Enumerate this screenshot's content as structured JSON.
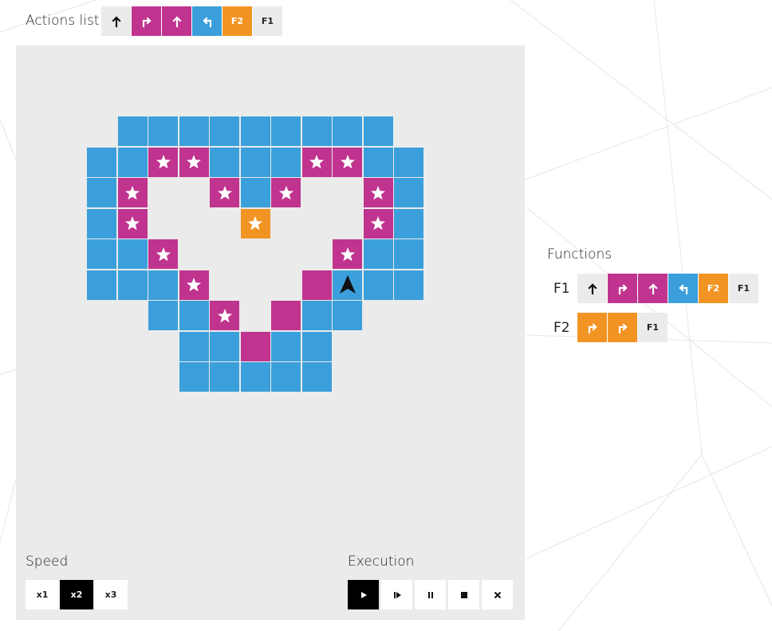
{
  "actions": {
    "label": "Actions list",
    "commands": [
      {
        "dir": "forward",
        "color": "none"
      },
      {
        "dir": "right",
        "color": "magenta"
      },
      {
        "dir": "forward",
        "color": "magenta"
      },
      {
        "dir": "left",
        "color": "blue"
      },
      {
        "text": "F2",
        "color": "orange"
      },
      {
        "text": "F1",
        "color": "none"
      }
    ]
  },
  "board": {
    "cells": [
      {
        "r": 0,
        "c": 1,
        "color": "blue"
      },
      {
        "r": 0,
        "c": 2,
        "color": "blue"
      },
      {
        "r": 0,
        "c": 3,
        "color": "blue"
      },
      {
        "r": 0,
        "c": 4,
        "color": "blue"
      },
      {
        "r": 0,
        "c": 5,
        "color": "blue"
      },
      {
        "r": 0,
        "c": 6,
        "color": "blue"
      },
      {
        "r": 0,
        "c": 7,
        "color": "blue"
      },
      {
        "r": 0,
        "c": 8,
        "color": "blue"
      },
      {
        "r": 0,
        "c": 9,
        "color": "blue"
      },
      {
        "r": 1,
        "c": 0,
        "color": "blue"
      },
      {
        "r": 1,
        "c": 1,
        "color": "blue"
      },
      {
        "r": 1,
        "c": 2,
        "color": "magenta",
        "star": true
      },
      {
        "r": 1,
        "c": 3,
        "color": "magenta",
        "star": true
      },
      {
        "r": 1,
        "c": 4,
        "color": "blue"
      },
      {
        "r": 1,
        "c": 5,
        "color": "blue"
      },
      {
        "r": 1,
        "c": 6,
        "color": "blue"
      },
      {
        "r": 1,
        "c": 7,
        "color": "magenta",
        "star": true
      },
      {
        "r": 1,
        "c": 8,
        "color": "magenta",
        "star": true
      },
      {
        "r": 1,
        "c": 9,
        "color": "blue"
      },
      {
        "r": 1,
        "c": 10,
        "color": "blue"
      },
      {
        "r": 2,
        "c": 0,
        "color": "blue"
      },
      {
        "r": 2,
        "c": 1,
        "color": "magenta",
        "star": true
      },
      {
        "r": 2,
        "c": 4,
        "color": "magenta",
        "star": true
      },
      {
        "r": 2,
        "c": 5,
        "color": "blue"
      },
      {
        "r": 2,
        "c": 6,
        "color": "magenta",
        "star": true
      },
      {
        "r": 2,
        "c": 9,
        "color": "magenta",
        "star": true
      },
      {
        "r": 2,
        "c": 10,
        "color": "blue"
      },
      {
        "r": 3,
        "c": 0,
        "color": "blue"
      },
      {
        "r": 3,
        "c": 1,
        "color": "magenta",
        "star": true
      },
      {
        "r": 3,
        "c": 5,
        "color": "orange",
        "star": true
      },
      {
        "r": 3,
        "c": 9,
        "color": "magenta",
        "star": true
      },
      {
        "r": 3,
        "c": 10,
        "color": "blue"
      },
      {
        "r": 4,
        "c": 0,
        "color": "blue"
      },
      {
        "r": 4,
        "c": 1,
        "color": "blue"
      },
      {
        "r": 4,
        "c": 2,
        "color": "magenta",
        "star": true
      },
      {
        "r": 4,
        "c": 8,
        "color": "magenta",
        "star": true
      },
      {
        "r": 4,
        "c": 9,
        "color": "blue"
      },
      {
        "r": 4,
        "c": 10,
        "color": "blue"
      },
      {
        "r": 5,
        "c": 0,
        "color": "blue"
      },
      {
        "r": 5,
        "c": 1,
        "color": "blue"
      },
      {
        "r": 5,
        "c": 2,
        "color": "blue"
      },
      {
        "r": 5,
        "c": 3,
        "color": "magenta",
        "star": true
      },
      {
        "r": 5,
        "c": 7,
        "color": "magenta"
      },
      {
        "r": 5,
        "c": 8,
        "color": "blue",
        "robot": true
      },
      {
        "r": 5,
        "c": 9,
        "color": "blue"
      },
      {
        "r": 5,
        "c": 10,
        "color": "blue"
      },
      {
        "r": 6,
        "c": 2,
        "color": "blue"
      },
      {
        "r": 6,
        "c": 3,
        "color": "blue"
      },
      {
        "r": 6,
        "c": 4,
        "color": "magenta",
        "star": true
      },
      {
        "r": 6,
        "c": 6,
        "color": "magenta"
      },
      {
        "r": 6,
        "c": 7,
        "color": "blue"
      },
      {
        "r": 6,
        "c": 8,
        "color": "blue"
      },
      {
        "r": 7,
        "c": 3,
        "color": "blue"
      },
      {
        "r": 7,
        "c": 4,
        "color": "blue"
      },
      {
        "r": 7,
        "c": 5,
        "color": "magenta"
      },
      {
        "r": 7,
        "c": 6,
        "color": "blue"
      },
      {
        "r": 7,
        "c": 7,
        "color": "blue"
      },
      {
        "r": 8,
        "c": 3,
        "color": "blue"
      },
      {
        "r": 8,
        "c": 4,
        "color": "blue"
      },
      {
        "r": 8,
        "c": 5,
        "color": "blue"
      },
      {
        "r": 8,
        "c": 6,
        "color": "blue"
      },
      {
        "r": 8,
        "c": 7,
        "color": "blue"
      }
    ]
  },
  "colors": {
    "blue": "#3b9fdb",
    "magenta": "#c0348f",
    "orange": "#f29423",
    "none": "#ebebeb",
    "panel": "#ebebeb"
  },
  "speed": {
    "label": "Speed",
    "options": [
      {
        "label": "x1",
        "active": false
      },
      {
        "label": "x2",
        "active": true
      },
      {
        "label": "x3",
        "active": false
      }
    ]
  },
  "execution": {
    "label": "Execution",
    "buttons": [
      {
        "icon": "play-icon",
        "active": true
      },
      {
        "icon": "step-icon",
        "active": false
      },
      {
        "icon": "pause-icon",
        "active": false
      },
      {
        "icon": "stop-icon",
        "active": false
      },
      {
        "icon": "clear-icon",
        "active": false
      }
    ]
  },
  "functions": {
    "label": "Functions",
    "f1": {
      "name": "F1",
      "commands": [
        {
          "dir": "forward",
          "color": "none"
        },
        {
          "dir": "right",
          "color": "magenta"
        },
        {
          "dir": "forward",
          "color": "magenta"
        },
        {
          "dir": "left",
          "color": "blue"
        },
        {
          "text": "F2",
          "color": "orange"
        },
        {
          "text": "F1",
          "color": "none"
        }
      ]
    },
    "f2": {
      "name": "F2",
      "commands": [
        {
          "dir": "right",
          "color": "orange"
        },
        {
          "dir": "right",
          "color": "orange"
        },
        {
          "text": "F1",
          "color": "none"
        }
      ]
    }
  }
}
